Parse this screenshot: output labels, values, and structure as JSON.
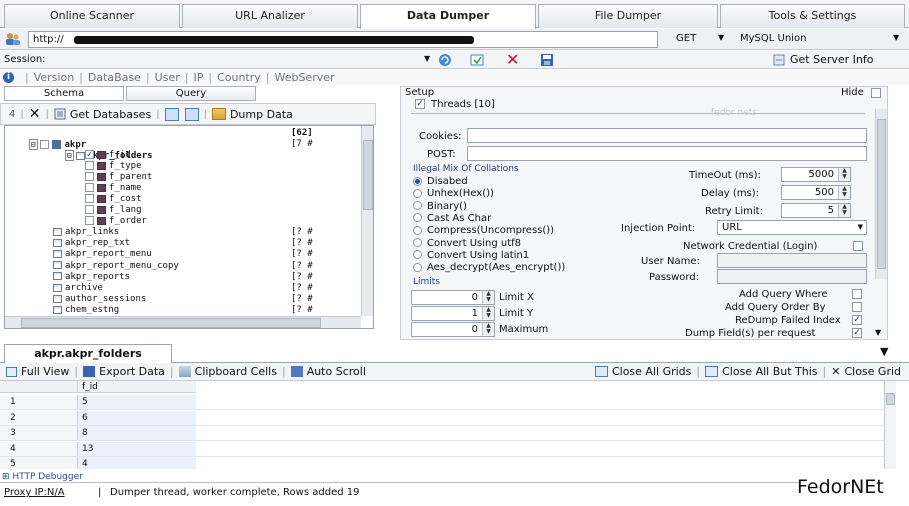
{
  "main_tabs": [
    "Online Scanner",
    "URL Analizer",
    "Data Dumper",
    "File Dumper",
    "Tools & Settings"
  ],
  "url": {
    "value": "http://",
    "method": "GET",
    "mode": "MySQL Union"
  },
  "session": {
    "label": "Session:",
    "server_info": "Get Server Info"
  },
  "links": [
    "Version",
    "DataBase",
    "User",
    "IP",
    "Country",
    "WebServer"
  ],
  "subtabs": {
    "schema": "Schema",
    "query": "Query"
  },
  "left_toolbar": {
    "count": "4",
    "get_databases": "Get Databases",
    "dump_data": "Dump Data"
  },
  "tree": {
    "db": {
      "name": "akpr",
      "count": "[62]"
    },
    "folders": {
      "name": "akpr_folders",
      "count": "[7 #"
    },
    "fields": [
      "f_id",
      "f_type",
      "f_parent",
      "f_name",
      "f_cost",
      "f_lang",
      "f_order"
    ],
    "tables": [
      {
        "name": "akpr_links",
        "count": "[? #"
      },
      {
        "name": "akpr_rep_txt",
        "count": "[? #"
      },
      {
        "name": "akpr_report_menu",
        "count": "[? #"
      },
      {
        "name": "akpr_report_menu_copy",
        "count": "[? #"
      },
      {
        "name": "akpr_reports",
        "count": "[? #"
      },
      {
        "name": "archive",
        "count": "[? #"
      },
      {
        "name": "author_sessions",
        "count": "[? #"
      },
      {
        "name": "chem_estng",
        "count": "[? #"
      }
    ]
  },
  "setup": {
    "title": "Setup",
    "hide": "Hide",
    "threads": "Threads [10]",
    "watermark": "fedor nets",
    "cookies": "Cookies:",
    "post": "POST:",
    "collations_title": "Illegal Mix Of Collations",
    "collations": [
      "Disabed",
      "Unhex(Hex())",
      "Binary()",
      "Cast As Char",
      "Compress(Uncompress())",
      "Convert Using utf8",
      "Convert Using latin1",
      "Aes_decrypt(Aes_encrypt())"
    ],
    "timeout_label": "TimeOut (ms):",
    "timeout": "5000",
    "delay_label": "Delay (ms):",
    "delay": "500",
    "retry_label": "Retry Limit:",
    "retry": "5",
    "injection_label": "Injection Point:",
    "injection": "URL",
    "network_cred": "Network Credential (Login)",
    "username": "User Name:",
    "password": "Password:",
    "limits_title": "Limits",
    "limit_x_label": "Limit X",
    "limit_x": "0",
    "limit_y_label": "Limit Y",
    "limit_y": "1",
    "maximum_label": "Maximum",
    "maximum": "0",
    "add_where": "Add Query Where",
    "add_order": "Add Query Order By",
    "redump": "ReDump Failed Index",
    "dump_field": "Dump Field(s) per request"
  },
  "result_tab": "akpr.akpr_folders",
  "grid_toolbar": {
    "full_view": "Full View",
    "export": "Export Data",
    "clipboard": "Clipboard Cells",
    "autoscroll": "Auto Scroll",
    "close_all": "Close All Grids",
    "close_but": "Close All But This",
    "close_grid": "Close Grid"
  },
  "grid": {
    "header": "f_id",
    "rows": [
      {
        "n": "1",
        "v": "5"
      },
      {
        "n": "2",
        "v": "6"
      },
      {
        "n": "3",
        "v": "8"
      },
      {
        "n": "4",
        "v": "13"
      },
      {
        "n": "5",
        "v": "4"
      }
    ]
  },
  "status": {
    "http": "HTTP Debugger",
    "proxy": "Proxy IP:N/A",
    "message": "Dumper thread, worker complete, Rows added 19",
    "brand": "FedorNEt"
  },
  "colors": {
    "accent": "#1e3f9a",
    "tab_active": "#ffffff",
    "selection": "#eaf1fb"
  }
}
